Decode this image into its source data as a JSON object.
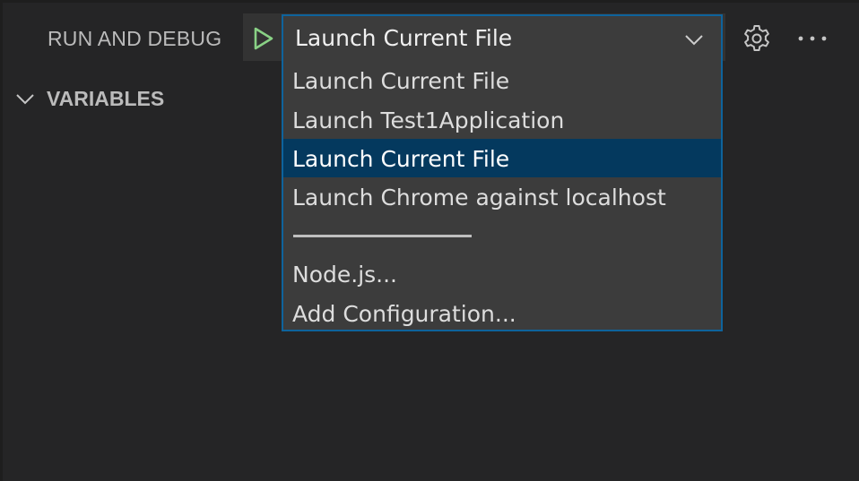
{
  "panel": {
    "title": "RUN AND DEBUG"
  },
  "toolbar": {
    "start_icon": "play-icon",
    "selected_configuration": "Launch Current File",
    "dropdown_icon": "chevron-down-icon",
    "settings_icon": "gear-icon",
    "more_icon": "ellipsis-icon"
  },
  "sections": {
    "variables": {
      "label": "VARIABLES",
      "expanded": true,
      "icon": "chevron-down-icon"
    }
  },
  "dropdown": {
    "items": [
      {
        "label": "Launch Current File"
      },
      {
        "label": "Launch Test1Application"
      },
      {
        "label": "Launch Current File",
        "selected": true
      },
      {
        "label": "Launch Chrome against localhost"
      },
      {
        "label": "Node.js..."
      },
      {
        "label": "Add Configuration..."
      }
    ]
  },
  "colors": {
    "background": "#252526",
    "toolbar_background": "#333333",
    "select_background": "#3c3c3c",
    "focus_border": "#0e639c",
    "selected_item": "#04395e",
    "play_green": "#89d185",
    "text": "#cccccc"
  }
}
